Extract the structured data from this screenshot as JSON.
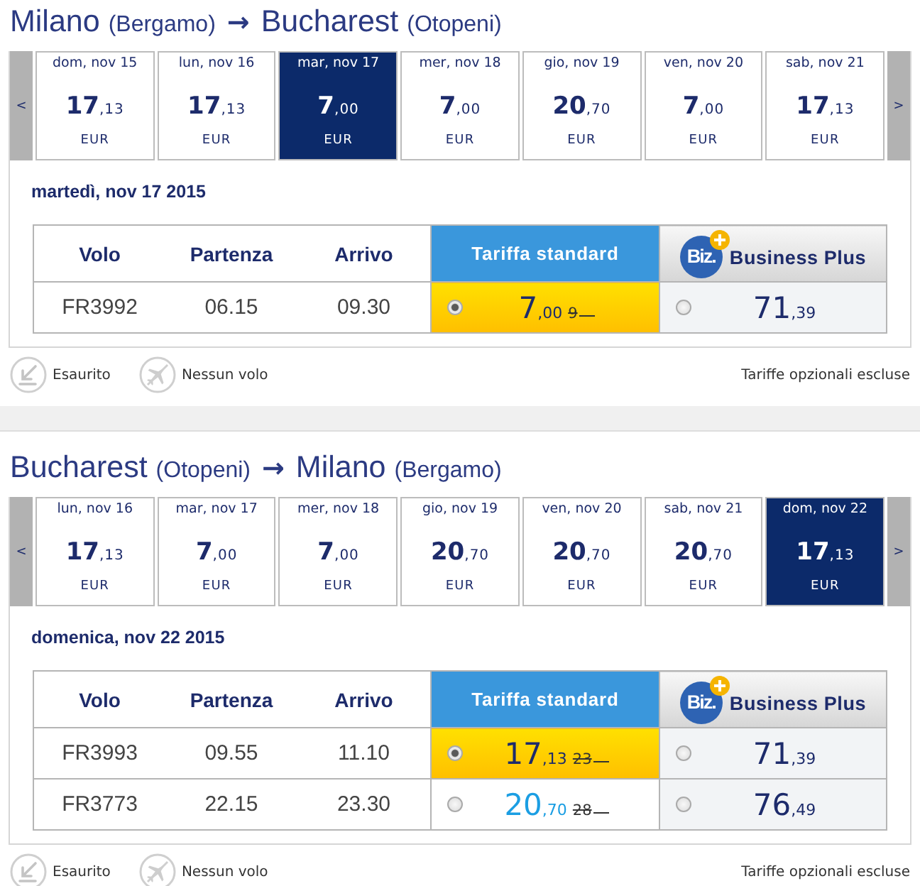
{
  "trips": [
    {
      "route": {
        "origin": "Milano",
        "origin_airport": "(Bergamo)",
        "arrow": "→",
        "destination": "Bucharest",
        "destination_airport": "(Otopeni)"
      },
      "dates": {
        "previous": "<",
        "next": ">",
        "days": [
          {
            "label": "dom, nov 15",
            "price": "17,13",
            "currency": "EUR",
            "selected": false
          },
          {
            "label": "lun, nov 16",
            "price": "17,13",
            "currency": "EUR",
            "selected": false
          },
          {
            "label": "mar, nov 17",
            "price": "7,00",
            "currency": "EUR",
            "selected": true
          },
          {
            "label": "mer, nov 18",
            "price": "7,00",
            "currency": "EUR",
            "selected": false
          },
          {
            "label": "gio, nov 19",
            "price": "20,70",
            "currency": "EUR",
            "selected": false
          },
          {
            "label": "ven, nov 20",
            "price": "7,00",
            "currency": "EUR",
            "selected": false
          },
          {
            "label": "sab, nov 21",
            "price": "17,13",
            "currency": "EUR",
            "selected": false
          }
        ]
      },
      "day_title": "martedì, nov 17 2015",
      "table": {
        "columns": [
          "Volo",
          "Partenza",
          "Arrivo"
        ],
        "standard_header": "Tariffa standard",
        "business_header": {
          "logo": "Biz.",
          "label": "Business Plus"
        },
        "rows": [
          {
            "flight": "FR3992",
            "departure": "06.15",
            "arrival": "09.30",
            "standard": {
              "price": "7,00",
              "old_price": "9",
              "selected": true
            },
            "business": {
              "price": "71,39",
              "selected": false
            }
          }
        ]
      },
      "legend": [
        {
          "kind": "sold_out",
          "label": "Esaurito"
        },
        {
          "kind": "no_flight",
          "label": "Nessun volo"
        }
      ],
      "note": "Tariffe opzionali escluse"
    },
    {
      "route": {
        "origin": "Bucharest",
        "origin_airport": "(Otopeni)",
        "arrow": "→",
        "destination": "Milano",
        "destination_airport": "(Bergamo)"
      },
      "dates": {
        "previous": "<",
        "next": ">",
        "days": [
          {
            "label": "lun, nov 16",
            "price": "17,13",
            "currency": "EUR",
            "selected": false
          },
          {
            "label": "mar, nov 17",
            "price": "7,00",
            "currency": "EUR",
            "selected": false
          },
          {
            "label": "mer, nov 18",
            "price": "7,00",
            "currency": "EUR",
            "selected": false
          },
          {
            "label": "gio, nov 19",
            "price": "20,70",
            "currency": "EUR",
            "selected": false
          },
          {
            "label": "ven, nov 20",
            "price": "20,70",
            "currency": "EUR",
            "selected": false
          },
          {
            "label": "sab, nov 21",
            "price": "20,70",
            "currency": "EUR",
            "selected": false
          },
          {
            "label": "dom, nov 22",
            "price": "17,13",
            "currency": "EUR",
            "selected": true
          }
        ]
      },
      "day_title": "domenica, nov 22 2015",
      "table": {
        "columns": [
          "Volo",
          "Partenza",
          "Arrivo"
        ],
        "standard_header": "Tariffa standard",
        "business_header": {
          "logo": "Biz.",
          "label": "Business Plus"
        },
        "rows": [
          {
            "flight": "FR3993",
            "departure": "09.55",
            "arrival": "11.10",
            "standard": {
              "price": "17,13",
              "old_price": "23",
              "selected": true
            },
            "business": {
              "price": "71,39",
              "selected": false
            }
          },
          {
            "flight": "FR3773",
            "departure": "22.15",
            "arrival": "23.30",
            "standard": {
              "price": "20,70",
              "old_price": "28",
              "selected": false
            },
            "business": {
              "price": "76,49",
              "selected": false
            }
          }
        ]
      },
      "legend": [
        {
          "kind": "sold_out",
          "label": "Esaurito"
        },
        {
          "kind": "no_flight",
          "label": "Nessun volo"
        }
      ],
      "note": "Tariffe opzionali escluse"
    }
  ]
}
